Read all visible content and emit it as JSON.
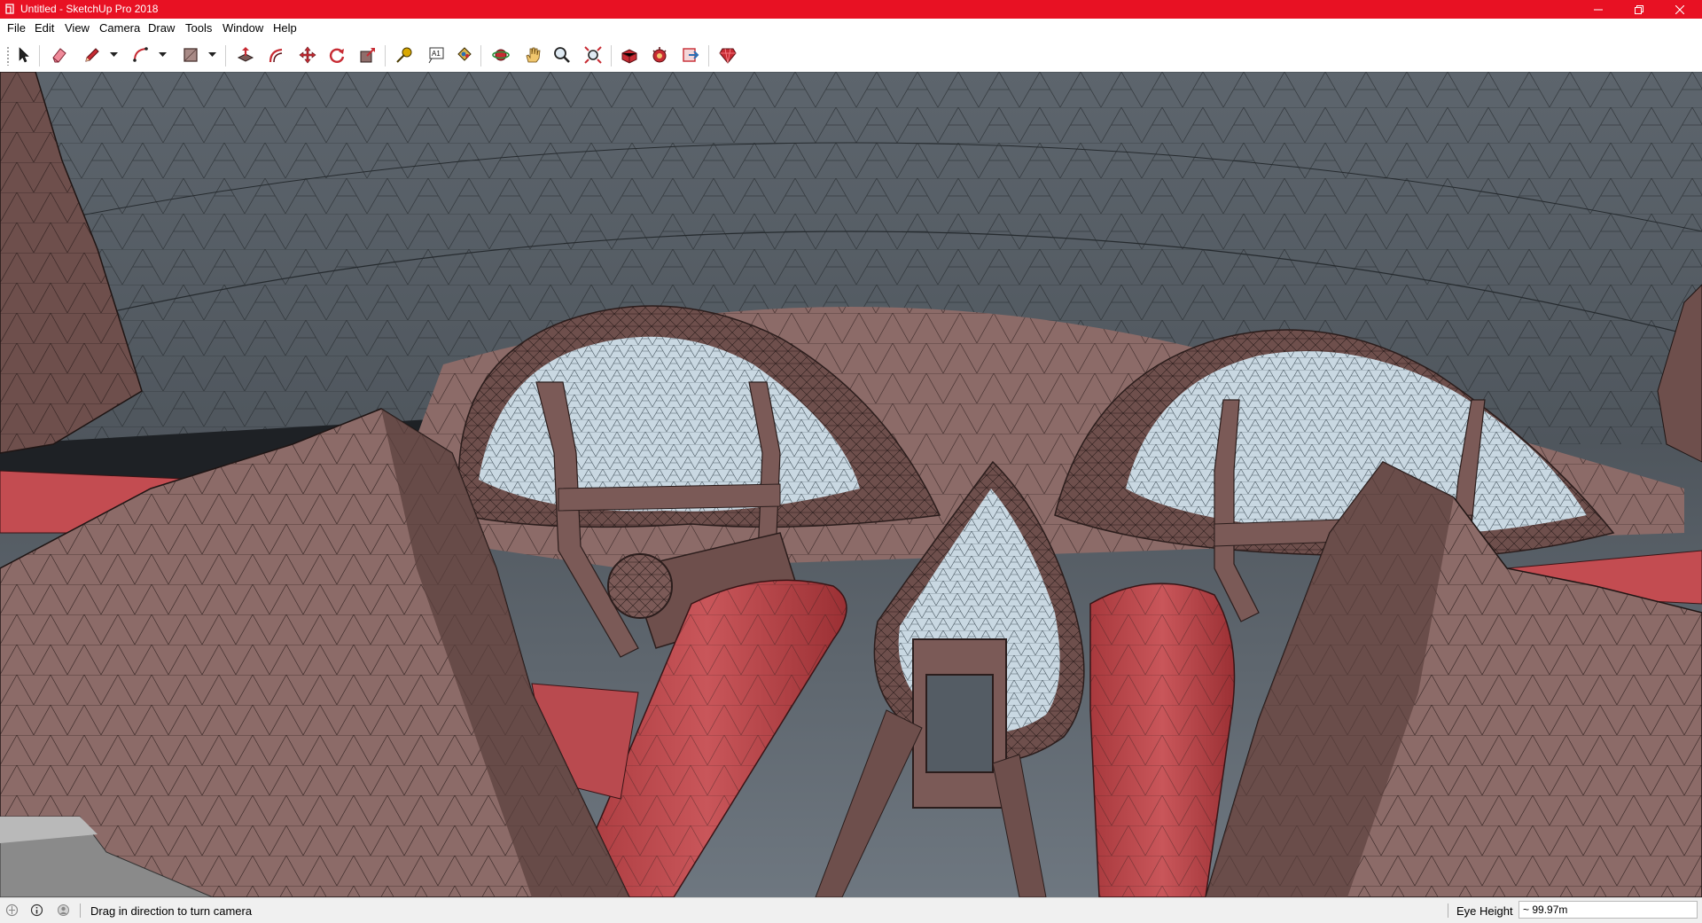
{
  "window": {
    "title": "Untitled - SketchUp Pro 2018",
    "title_bar_color": "#e81123",
    "controls": [
      "minimize-icon",
      "restore-icon",
      "close-icon"
    ]
  },
  "menu": [
    "File",
    "Edit",
    "View",
    "Camera",
    "Draw",
    "Tools",
    "Window",
    "Help"
  ],
  "toolbar": {
    "tools": [
      {
        "name": "select-tool",
        "icon": "arrow-icon"
      },
      {
        "name": "eraser-tool",
        "icon": "eraser-icon"
      },
      {
        "name": "line-tool",
        "icon": "pencil-icon",
        "dropdown": true
      },
      {
        "name": "arc-tool",
        "icon": "arc-icon",
        "dropdown": true
      },
      {
        "name": "shape-tool",
        "icon": "rectangle-icon",
        "dropdown": true
      },
      {
        "name": "push-pull-tool",
        "icon": "push-pull-icon"
      },
      {
        "name": "offset-tool",
        "icon": "offset-icon"
      },
      {
        "name": "move-tool",
        "icon": "move-icon"
      },
      {
        "name": "rotate-tool",
        "icon": "rotate-icon"
      },
      {
        "name": "scale-tool",
        "icon": "scale-icon"
      },
      {
        "name": "tape-measure-tool",
        "icon": "tape-measure-icon"
      },
      {
        "name": "text-tool",
        "icon": "text-icon"
      },
      {
        "name": "paint-bucket-tool",
        "icon": "paint-bucket-icon"
      },
      {
        "name": "orbit-tool",
        "icon": "orbit-icon"
      },
      {
        "name": "pan-tool",
        "icon": "hand-icon"
      },
      {
        "name": "zoom-tool",
        "icon": "magnifier-icon"
      },
      {
        "name": "zoom-extents-tool",
        "icon": "zoom-extents-icon"
      },
      {
        "name": "3d-warehouse",
        "icon": "warehouse-icon"
      },
      {
        "name": "extension-warehouse",
        "icon": "extension-icon"
      },
      {
        "name": "send-to-layout",
        "icon": "layout-icon"
      },
      {
        "name": "extension-manager",
        "icon": "ruby-icon"
      }
    ],
    "text_tool_glyph": "A1"
  },
  "status": {
    "message": "Drag in direction to turn camera",
    "icons": [
      "geo-location-icon",
      "credits-icon",
      "user-icon"
    ]
  },
  "measurements": {
    "label": "Eye Height",
    "value": "~ 99.97m"
  },
  "colors": {
    "accent_red": "#cc1f28",
    "viewport_sky": "#545c64",
    "model_face": "#8c6b68",
    "glass": "#c9d8e2"
  }
}
